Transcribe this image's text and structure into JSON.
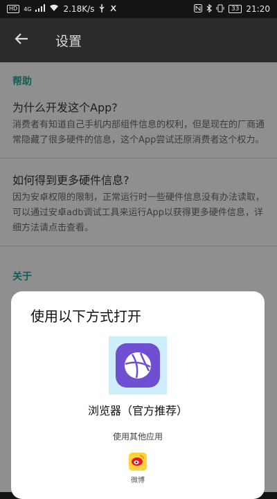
{
  "status_bar": {
    "hd": "HD",
    "network": "4G",
    "speed": "2.18K/s",
    "battery": "33",
    "time": "21:20"
  },
  "app_bar": {
    "title": "设置"
  },
  "settings": {
    "help_header": "帮助",
    "why_title": "为什么开发这个App?",
    "why_summary": "消费者有知道自己手机内部组件信息的权利，但是现在的厂商通常隐藏了很多硬件的信息，这个App尝试还原消费者这个权力。",
    "more_title": "如何得到更多硬件信息?",
    "more_summary": "因为安卓权限的限制，正常运行时一些硬件信息没有办法读取，可以通过安卓adb调试工具来运行App以获得更多硬件信息，详细方法请点击查看。",
    "about_header": "关于"
  },
  "open_with": {
    "title": "使用以下方式打开",
    "browser_label": "浏览器（官方推荐）",
    "other_apps": "使用其他应用",
    "weibo_label": "微博"
  }
}
